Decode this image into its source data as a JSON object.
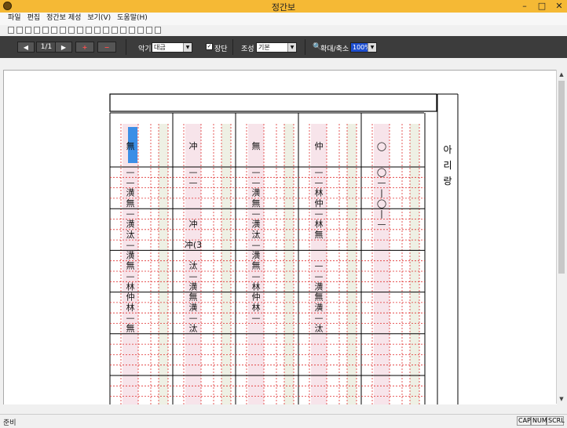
{
  "window": {
    "title": "정간보",
    "buttons": [
      "–",
      "□",
      "✕"
    ]
  },
  "menu": [
    "파일",
    "편집",
    "정간보 제성",
    "보기(V)",
    "도움말(H)"
  ],
  "toolbar": {
    "icons": [
      "new-doc-icon",
      "open-folder-icon",
      "save-icon",
      "print-icon",
      "print-preview-icon",
      "grid-icon",
      "grid-alt-icon",
      "undo-icon",
      "redo-icon",
      "image-icon",
      "record-icon",
      "note-icon",
      "settings-icon",
      "copy-icon",
      "music-icon",
      "play-icon",
      "help-icon",
      "dropdown-icon"
    ]
  },
  "nav": {
    "prev": "◀",
    "page": "1/1",
    "next": "▶",
    "add_page": "+",
    "remove_page": "−"
  },
  "instrument": {
    "label": "악기",
    "value": "대금"
  },
  "jangdan": {
    "label": "장단",
    "checked": true
  },
  "mode": {
    "label": "조성",
    "value": "기본"
  },
  "zoom": {
    "label": "확대/축소",
    "value": "100%"
  },
  "score": {
    "side_text": "아 리 랑",
    "top_row": [
      [
        "無",
        "冲",
        "無",
        "仲",
        "◯"
      ],
      [
        "—",
        "—",
        "—",
        "—",
        "◯"
      ],
      [
        "—",
        "—",
        "—",
        "—",
        "—"
      ],
      [
        "潢",
        "",
        "潢",
        "林",
        "|"
      ],
      [
        "無",
        "",
        "無",
        "仲",
        "◯"
      ],
      [
        "—",
        "",
        "—",
        "—",
        "|"
      ],
      [
        "潢",
        "冲",
        "潢",
        "林",
        "—"
      ],
      [
        "汰",
        "",
        "汰",
        "無",
        ""
      ],
      [
        "—",
        "冲(3",
        "—",
        "",
        ""
      ],
      [
        "潢",
        "",
        "潢",
        "",
        ""
      ],
      [
        "無",
        "汰",
        "無",
        "—",
        ""
      ],
      [
        "—",
        "—",
        "—",
        "—",
        ""
      ],
      [
        "林",
        "潢",
        "林",
        "潢",
        ""
      ],
      [
        "仲",
        "無",
        "仲",
        "無",
        ""
      ],
      [
        "林",
        "潢",
        "林",
        "潢",
        ""
      ],
      [
        "—",
        "—",
        "—",
        "—",
        ""
      ],
      [
        "無",
        "汰",
        "",
        "汰",
        ""
      ]
    ]
  },
  "status": {
    "text": "준비",
    "indicators": [
      "CAP",
      "NUM",
      "SCRL"
    ]
  }
}
